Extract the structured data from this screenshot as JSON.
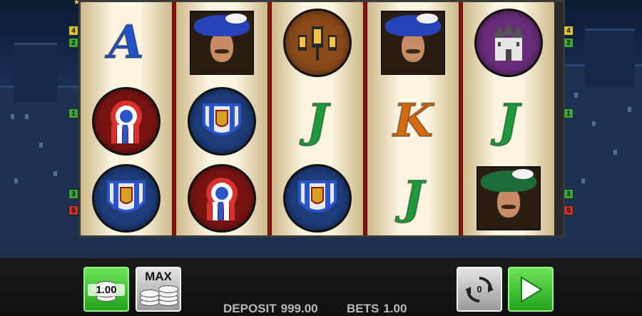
{
  "reels": [
    {
      "symbols": [
        {
          "name": "letter-a",
          "text": "A",
          "color": "#2452c9"
        },
        {
          "name": "rosette-badge",
          "kind": "rosette"
        },
        {
          "name": "shield-badge",
          "kind": "shield"
        }
      ]
    },
    {
      "symbols": [
        {
          "name": "musketeer-blue-hat",
          "kind": "portrait-blue"
        },
        {
          "name": "shield-badge",
          "kind": "shield"
        },
        {
          "name": "rosette-badge",
          "kind": "rosette"
        }
      ]
    },
    {
      "symbols": [
        {
          "name": "lanterns-medallion",
          "kind": "lantern"
        },
        {
          "name": "letter-j",
          "text": "J",
          "color": "#1f9a3a"
        },
        {
          "name": "shield-badge",
          "kind": "shield"
        }
      ]
    },
    {
      "symbols": [
        {
          "name": "musketeer-blue-hat",
          "kind": "portrait-blue"
        },
        {
          "name": "letter-k",
          "text": "K",
          "color": "#d46a12"
        },
        {
          "name": "letter-j",
          "text": "J",
          "color": "#1f9a3a"
        }
      ]
    },
    {
      "symbols": [
        {
          "name": "castle-medallion",
          "kind": "castle"
        },
        {
          "name": "letter-j",
          "text": "J",
          "color": "#1f9a3a"
        },
        {
          "name": "musketeer-green-hat",
          "kind": "portrait-green"
        }
      ]
    }
  ],
  "paylines": {
    "left": [
      {
        "num": "4",
        "color": "#d8c23a"
      },
      {
        "num": "2",
        "color": "#3aa83a"
      },
      {
        "num": "1",
        "color": "#3aa83a"
      },
      {
        "num": "3",
        "color": "#3aa83a"
      },
      {
        "num": "5",
        "color": "#c8342a"
      }
    ],
    "right": [
      {
        "num": "4",
        "color": "#d8c23a"
      },
      {
        "num": "2",
        "color": "#3aa83a"
      },
      {
        "num": "1",
        "color": "#3aa83a"
      },
      {
        "num": "3",
        "color": "#3aa83a"
      },
      {
        "num": "5",
        "color": "#c8342a"
      }
    ]
  },
  "controls": {
    "bet_value": "1.00",
    "max_label": "MAX",
    "autoplay_count": "0",
    "deposit_label": "DEPOSIT",
    "deposit_value": "999.00",
    "bets_label": "BETS",
    "bets_value": "1.00"
  },
  "colors": {
    "reel_separator": "#8b0f0f",
    "spin_button": "#2fbf27"
  }
}
